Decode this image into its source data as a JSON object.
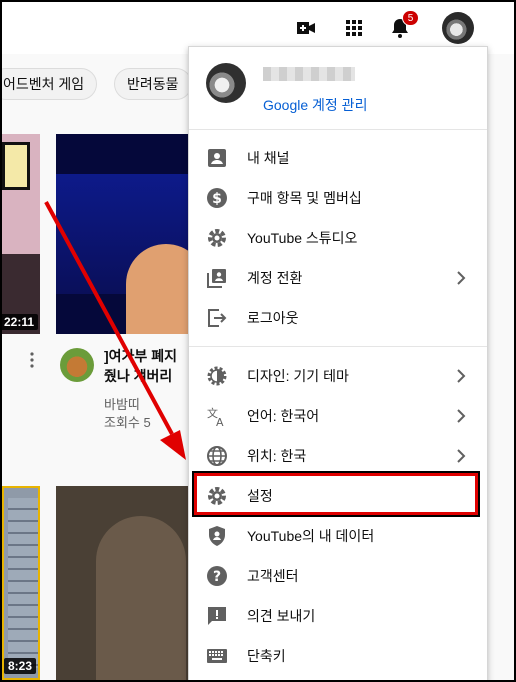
{
  "header": {
    "notification_count": "5",
    "icons": [
      "create-video-icon",
      "apps-icon",
      "bell-icon",
      "avatar"
    ]
  },
  "chips": [
    "어드벤처 게임",
    "반려동물"
  ],
  "videos": [
    {
      "duration": "22:11",
      "side": "left"
    },
    {
      "title_line1": "]여가부 폐지",
      "title_line2": "줬나 걔버리",
      "channel": "바밤띠",
      "views": "조회수 5"
    },
    {
      "duration": "8:23",
      "side": "left"
    }
  ],
  "menu": {
    "manage_account": "Google 계정 관리",
    "section1": [
      {
        "icon": "person-icon",
        "label": "내 채널",
        "chevron": false
      },
      {
        "icon": "dollar-icon",
        "label": "구매 항목 및 멤버십",
        "chevron": false
      },
      {
        "icon": "gear-icon",
        "label": "YouTube 스튜디오",
        "chevron": false
      },
      {
        "icon": "switch-account-icon",
        "label": "계정 전환",
        "chevron": true
      },
      {
        "icon": "sign-out-icon",
        "label": "로그아웃",
        "chevron": false
      }
    ],
    "section2": [
      {
        "icon": "theme-icon",
        "label": "디자인: 기기 테마",
        "chevron": true
      },
      {
        "icon": "translate-icon",
        "label": "언어: 한국어",
        "chevron": true
      },
      {
        "icon": "globe-icon",
        "label": "위치: 한국",
        "chevron": true
      },
      {
        "icon": "gear-icon",
        "label": "설정",
        "chevron": false
      },
      {
        "icon": "shield-person-icon",
        "label": "YouTube의 내 데이터",
        "chevron": false
      },
      {
        "icon": "help-icon",
        "label": "고객센터",
        "chevron": false
      },
      {
        "icon": "feedback-icon",
        "label": "의견 보내기",
        "chevron": false
      },
      {
        "icon": "keyboard-icon",
        "label": "단축키",
        "chevron": false
      }
    ]
  },
  "colors": {
    "annotation_red": "#e00000",
    "link_blue": "#065fd4",
    "badge_red": "#cc0000"
  }
}
